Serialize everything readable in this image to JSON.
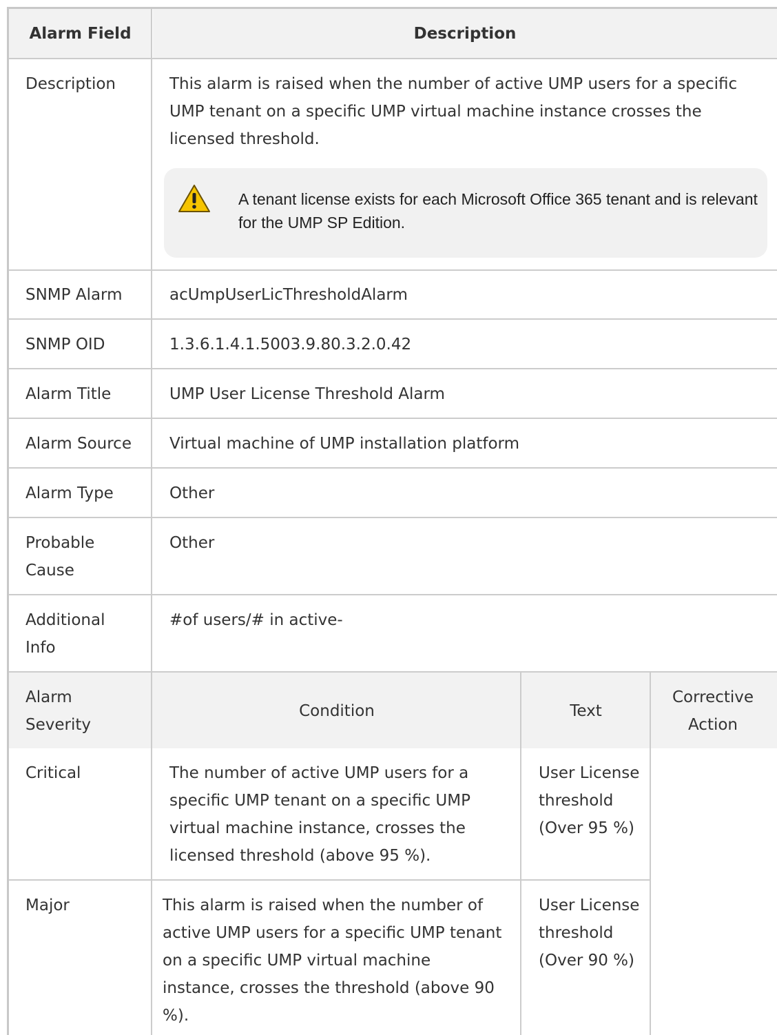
{
  "header": {
    "col1": "Alarm Field",
    "col2": "Description"
  },
  "description_row": {
    "label": "Description",
    "text": "This alarm is raised when the number of active UMP users for a specific UMP tenant on a specific UMP virtual machine instance crosses the licensed threshold.",
    "note": "A tenant license exists for each Microsoft Office 365 tenant and is relevant for the UMP SP Edition.",
    "note_icon": "warning-icon"
  },
  "rows": [
    {
      "label": "SNMP Alarm",
      "value": "acUmpUserLicThresholdAlarm"
    },
    {
      "label": "SNMP OID",
      "value": "1.3.6.1.4.1.5003.9.80.3.2.0.42"
    },
    {
      "label": "Alarm Title",
      "value": "UMP User License Threshold Alarm"
    },
    {
      "label": "Alarm Source",
      "value": "Virtual machine of UMP installation platform"
    },
    {
      "label": "Alarm Type",
      "value": "Other"
    },
    {
      "label": "Probable Cause",
      "value": "Other"
    },
    {
      "label": "Additional Info",
      "value": "#of users/# in active-"
    }
  ],
  "severity_header": {
    "severity": "Alarm Severity",
    "condition": "Condition",
    "text": "Text",
    "action": "Corrective Action"
  },
  "severity_rows": [
    {
      "severity": "Critical",
      "condition": "The number of active UMP users for a specific UMP tenant on a specific UMP virtual machine instance, crosses the licensed threshold (above 95 %).",
      "text": "User License threshold (Over 95 %)"
    },
    {
      "severity": "Major",
      "condition": "This alarm is raised when the number of active UMP users for a specific UMP tenant on a specific UMP virtual machine instance, crosses the threshold (above 90 %).",
      "text": "User License threshold (Over 90 %)"
    }
  ]
}
